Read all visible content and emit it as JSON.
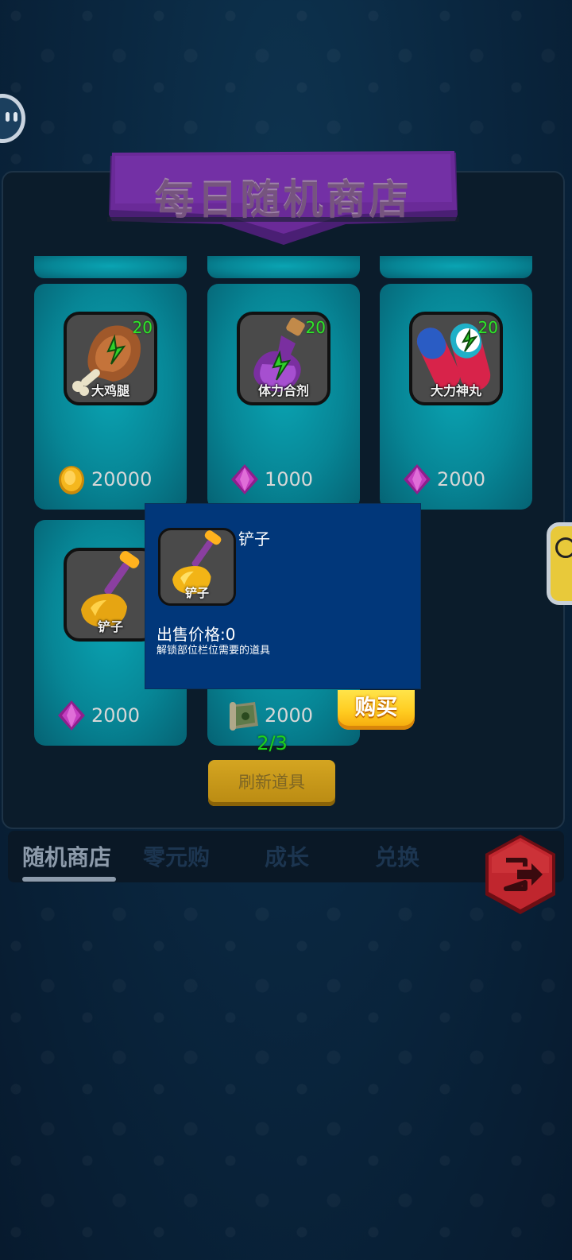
{
  "shop": {
    "title": "每日随机商店",
    "items": [
      {
        "name": "大鸡腿",
        "count": "20",
        "currency": "coin",
        "price": "20000"
      },
      {
        "name": "体力合剂",
        "count": "20",
        "currency": "gem",
        "price": "1000"
      },
      {
        "name": "大力神丸",
        "count": "20",
        "currency": "gem",
        "price": "2000"
      },
      {
        "name": "铲子",
        "count": "",
        "currency": "gem",
        "price": "2000"
      },
      {
        "name": "",
        "count": "",
        "currency": "scroll",
        "price": "2000"
      }
    ],
    "refresh_counter": "2/3",
    "refresh_label": "刷新道具"
  },
  "tabs": [
    {
      "label": "随机商店",
      "active": true
    },
    {
      "label": "零元购",
      "active": false
    },
    {
      "label": "成长",
      "active": false
    },
    {
      "label": "兑换",
      "active": false
    }
  ],
  "popup": {
    "icon_label": "铲子",
    "name": "铲子",
    "price_text": "出售价格:0",
    "description": "解锁部位栏位需要的道具",
    "buy_label": "购买"
  },
  "icons": {
    "exit": "exit-icon",
    "coin": "gold-coin-icon",
    "gem": "purple-gem-icon",
    "scroll": "map-scroll-icon"
  },
  "colors": {
    "banner": "#6a2a98",
    "card": "#0896a6",
    "popup_bg": "#01377a",
    "buy_button": "#ffcc20",
    "count_green": "#2ee62a"
  }
}
